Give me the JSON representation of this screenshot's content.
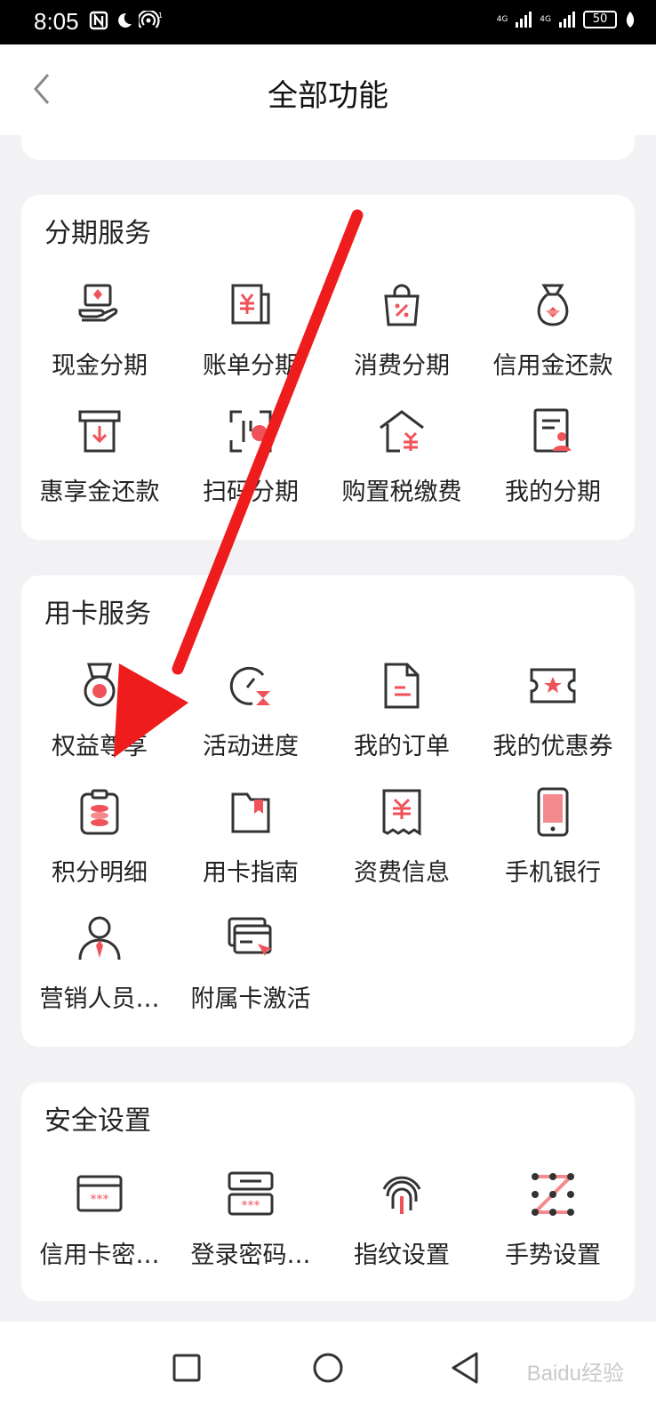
{
  "status": {
    "time": "8:05",
    "battery": "50",
    "network1": "4G",
    "network2": "4G"
  },
  "header": {
    "title": "全部功能"
  },
  "sections": [
    {
      "title": "分期服务",
      "items": [
        {
          "label": "现金分期",
          "icon": "cash-hand-icon"
        },
        {
          "label": "账单分期",
          "icon": "bill-icon"
        },
        {
          "label": "消费分期",
          "icon": "shopping-bag-icon"
        },
        {
          "label": "信用金还款",
          "icon": "money-bag-icon"
        },
        {
          "label": "惠享金还款",
          "icon": "download-box-icon"
        },
        {
          "label": "扫码分期",
          "icon": "scan-icon"
        },
        {
          "label": "购置税缴费",
          "icon": "house-yen-icon"
        },
        {
          "label": "我的分期",
          "icon": "user-doc-icon"
        }
      ]
    },
    {
      "title": "用卡服务",
      "items": [
        {
          "label": "权益尊享",
          "icon": "medal-icon"
        },
        {
          "label": "活动进度",
          "icon": "gauge-icon"
        },
        {
          "label": "我的订单",
          "icon": "order-doc-icon"
        },
        {
          "label": "我的优惠券",
          "icon": "coupon-icon"
        },
        {
          "label": "积分明细",
          "icon": "points-icon"
        },
        {
          "label": "用卡指南",
          "icon": "guide-book-icon"
        },
        {
          "label": "资费信息",
          "icon": "receipt-icon"
        },
        {
          "label": "手机银行",
          "icon": "phone-icon"
        },
        {
          "label": "营销人员…",
          "icon": "salesperson-icon"
        },
        {
          "label": "附属卡激活",
          "icon": "cards-icon"
        }
      ]
    },
    {
      "title": "安全设置",
      "items": [
        {
          "label": "信用卡密…",
          "icon": "card-password-icon"
        },
        {
          "label": "登录密码…",
          "icon": "login-password-icon"
        },
        {
          "label": "指纹设置",
          "icon": "fingerprint-icon"
        },
        {
          "label": "手势设置",
          "icon": "gesture-icon"
        }
      ]
    }
  ],
  "watermark": "Baidu经验",
  "colors": {
    "accent": "#f0525a",
    "annotation_arrow": "#ee1c1c"
  }
}
